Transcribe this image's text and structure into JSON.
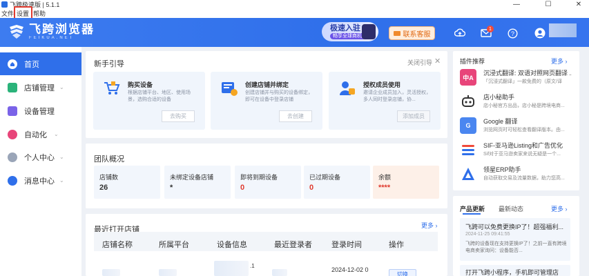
{
  "window": {
    "title": "飞跨极速版 | 5.1.1",
    "minimize": "—",
    "restore": "☐",
    "close": "✕"
  },
  "menu": {
    "items": [
      "文件",
      "设置",
      "帮助"
    ]
  },
  "header": {
    "logo_title": "飞跨浏览器",
    "logo_sub": "FEIKUA.NET",
    "promo_title": "极速入驻",
    "promo_sub": "畅享全球商机",
    "customer_service": "联系客服",
    "mail_badge": "1"
  },
  "sidebar": {
    "items": [
      {
        "label": "首页",
        "icon": "home-icon",
        "active": true,
        "chevron": false
      },
      {
        "label": "店铺管理",
        "icon": "store-icon",
        "chevron": true
      },
      {
        "label": "设备管理",
        "icon": "device-icon",
        "chevron": false
      },
      {
        "label": "自动化",
        "icon": "robot-icon",
        "chevron": true
      },
      {
        "label": "个人中心",
        "icon": "user-icon",
        "chevron": true
      },
      {
        "label": "消息中心",
        "icon": "bell-icon",
        "chevron": true
      }
    ]
  },
  "guide": {
    "title": "新手引导",
    "close_label": "关闭引导",
    "cards": [
      {
        "title": "购买设备",
        "desc": "根据店铺平台、地区、使用场景，选购合适的设备",
        "button": "去购买"
      },
      {
        "title": "创建店铺并绑定",
        "desc": "创建店铺并与购买的设备绑定，即可在设备中登录店铺",
        "button": "去创建"
      },
      {
        "title": "授权成员使用",
        "desc": "邀请企业成员加入，灵活授权，多人同时登录店铺，协...",
        "button": "添加成员"
      }
    ]
  },
  "team": {
    "title": "团队概况",
    "stats": [
      {
        "label": "店铺数",
        "value": "26",
        "highlight": false
      },
      {
        "label": "未绑定设备店铺",
        "value": "*",
        "highlight": false
      },
      {
        "label": "即将到期设备",
        "value": "0",
        "highlight": true
      },
      {
        "label": "已过期设备",
        "value": "0",
        "highlight": true
      },
      {
        "label": "余额",
        "value": "****",
        "highlight": true
      }
    ]
  },
  "recent": {
    "title": "最近打开店铺",
    "more": "更多 ›",
    "columns": [
      "店铺名称",
      "所属平台",
      "设备信息",
      "最近登录者",
      "登录时间",
      "操作"
    ],
    "row": {
      "login_time": "2024-12-02 0",
      "device_suffix": ".1",
      "action": "切换"
    }
  },
  "plugins": {
    "title": "插件推荐",
    "more": "更多 ›",
    "items": [
      {
        "name": "沉浸式翻译: 双语对照网页翻译 ...",
        "desc": "「沉浸式翻译」一款免费的（原文/译",
        "icon_text": "中A",
        "color": "#e8457a"
      },
      {
        "name": "店小秘助手",
        "desc": "店小秘官方出品，店小秘是跨境电商...",
        "icon_text": "",
        "color": "#333333"
      },
      {
        "name": "Google 翻译",
        "desc": "浏览网页时可轻松查看翻译版本。由...",
        "icon_text": "G",
        "color": "#4a86f0"
      },
      {
        "name": "SIF-亚马逊Listing和广告优化",
        "desc": "Sif对于亚马逊卖家来说无疑是一个...",
        "icon_text": "",
        "color": "#ffffff"
      },
      {
        "name": "领星ERP助手",
        "desc": "自动获取交易及流量数据，助力您高...",
        "icon_text": "",
        "color": "#2f6fea"
      }
    ]
  },
  "news": {
    "tabs": [
      "产品更新",
      "最新动态"
    ],
    "more": "更多 ›",
    "items": [
      {
        "title": "飞跨可以免费更换IP了！超强福利...",
        "date": "2024-11-25 09:41:55",
        "body": "飞跨的设备现在支持更换IP了！之前一直有跨境电商卖家询问：设备能否..."
      },
      {
        "title": "打开飞跨小程序，手机即可管理店",
        "date": "",
        "body": ""
      }
    ]
  }
}
